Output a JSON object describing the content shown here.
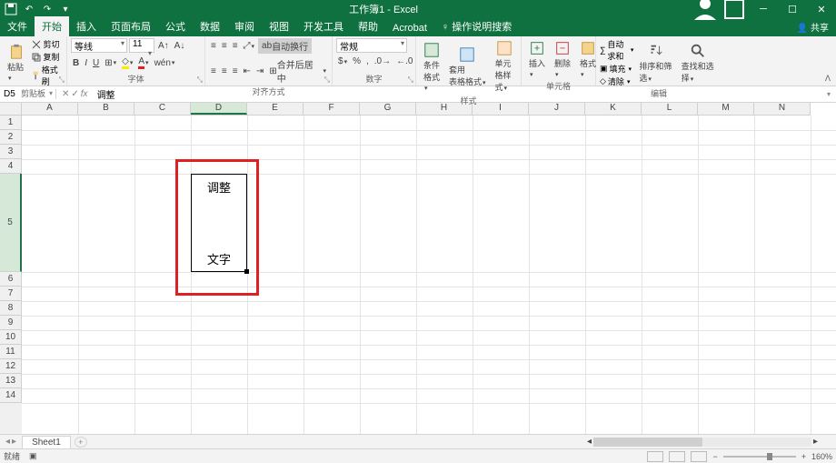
{
  "app": {
    "title": "工作簿1 - Excel"
  },
  "tabs": {
    "file": "文件",
    "home": "开始",
    "insert": "插入",
    "pagelayout": "页面布局",
    "formulas": "公式",
    "data": "数据",
    "review": "审阅",
    "view": "视图",
    "developer": "开发工具",
    "help": "帮助",
    "acrobat": "Acrobat",
    "tellme": "操作说明搜索",
    "share": "共享"
  },
  "ribbon": {
    "clipboard": {
      "label": "剪贴板",
      "paste": "粘贴",
      "cut": "剪切",
      "copy": "复制",
      "painter": "格式刷"
    },
    "font": {
      "label": "字体",
      "name": "等线",
      "size": "11"
    },
    "alignment": {
      "label": "对齐方式",
      "wrap": "自动换行",
      "merge": "合并后居中"
    },
    "number": {
      "label": "数字",
      "format": "常规"
    },
    "styles": {
      "label": "样式",
      "cond": "条件格式",
      "table": "套用\n表格格式",
      "cell": "单元格样式"
    },
    "cells": {
      "label": "单元格",
      "insert": "插入",
      "delete": "删除",
      "format": "格式"
    },
    "editing": {
      "label": "编辑",
      "autosum": "自动求和",
      "fill": "填充",
      "clear": "清除",
      "sort": "排序和筛选",
      "find": "查找和选择"
    }
  },
  "formula_bar": {
    "name_box": "D5",
    "fx": "fx",
    "value": "调整"
  },
  "columns": [
    "A",
    "B",
    "C",
    "D",
    "E",
    "F",
    "G",
    "H",
    "I",
    "J",
    "K",
    "L",
    "M",
    "N"
  ],
  "rows": [
    "1",
    "2",
    "3",
    "4",
    "5",
    "6",
    "7",
    "8",
    "9",
    "10",
    "11",
    "12",
    "13",
    "14"
  ],
  "cell_content": {
    "line1": "调整",
    "line2": "文字"
  },
  "sheet": {
    "name": "Sheet1"
  },
  "status": {
    "mode": "就绪",
    "zoom": "160%"
  },
  "colors": {
    "accent": "#0f7040",
    "red": "#e02020"
  }
}
